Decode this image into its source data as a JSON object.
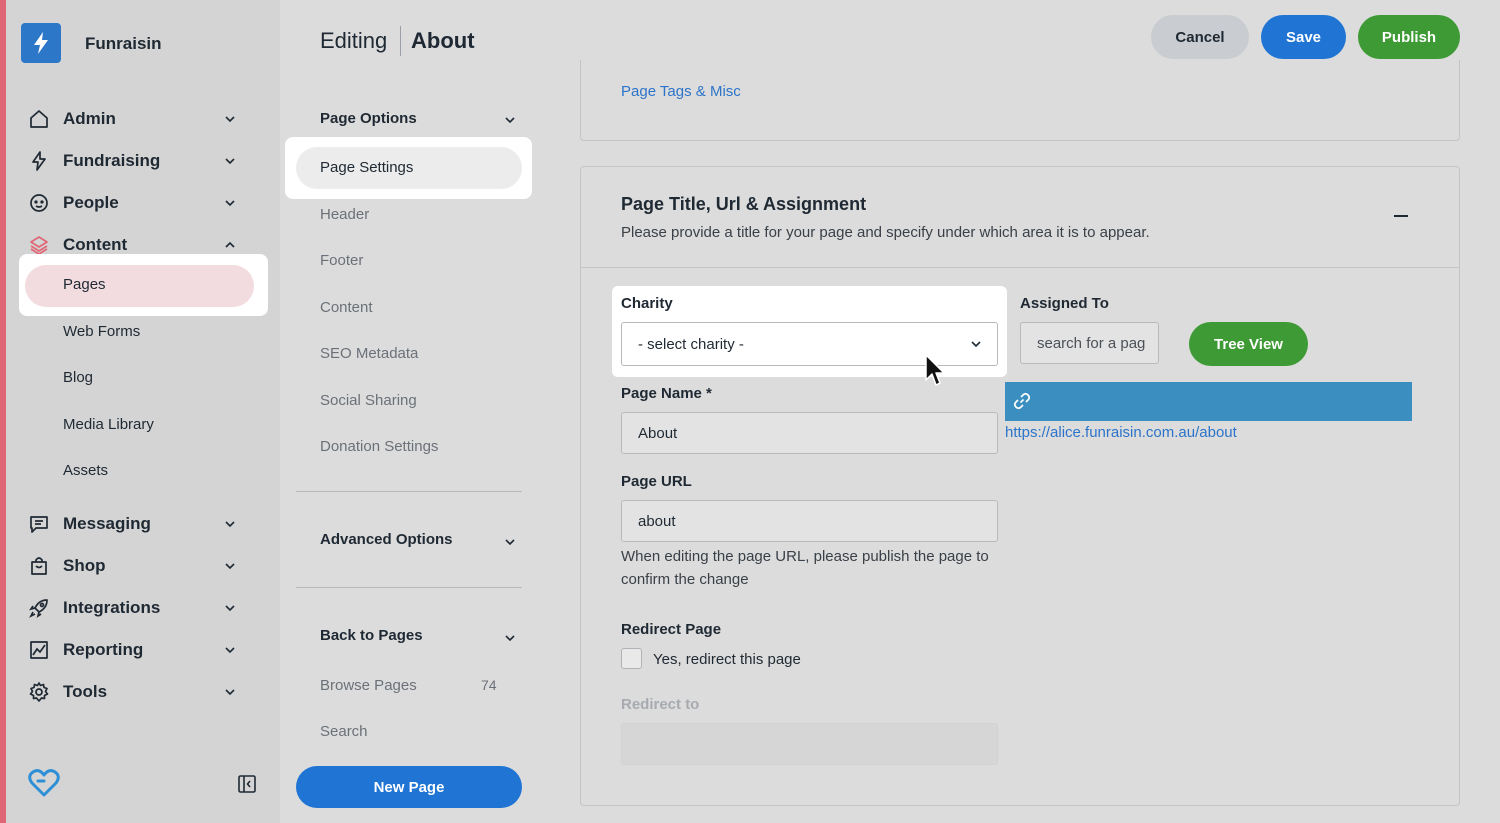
{
  "app": {
    "brand": "Funraisin",
    "colors": {
      "accent": "#e06676",
      "primary": "#1f74d4",
      "success": "#3d9a34",
      "link": "#2c74c9"
    }
  },
  "sidebar": {
    "nav": [
      {
        "label": "Admin",
        "icon": "home-icon"
      },
      {
        "label": "Fundraising",
        "icon": "lightning-icon"
      },
      {
        "label": "People",
        "icon": "face-icon"
      },
      {
        "label": "Content",
        "icon": "layers-icon",
        "expanded": true
      },
      {
        "label": "Messaging",
        "icon": "chat-icon"
      },
      {
        "label": "Shop",
        "icon": "shopping-bag-icon"
      },
      {
        "label": "Integrations",
        "icon": "rocket-icon"
      },
      {
        "label": "Reporting",
        "icon": "chart-icon"
      },
      {
        "label": "Tools",
        "icon": "gear-icon"
      }
    ],
    "content_items": [
      "Pages",
      "Web Forms",
      "Blog",
      "Media Library",
      "Assets"
    ],
    "active_item": "Pages"
  },
  "header": {
    "editing_label": "Editing",
    "page_title": "About",
    "cancel_label": "Cancel",
    "save_label": "Save",
    "publish_label": "Publish"
  },
  "page_options": {
    "title": "Page Options",
    "items": [
      "Page Settings",
      "Header",
      "Footer",
      "Content",
      "SEO Metadata",
      "Social Sharing",
      "Donation Settings"
    ],
    "active_item": "Page Settings",
    "advanced_title": "Advanced Options",
    "back_title": "Back to Pages",
    "browse_label": "Browse Pages",
    "browse_count": "74",
    "search_label": "Search",
    "new_page_label": "New Page"
  },
  "main": {
    "tags_link": "Page Tags & Misc",
    "section_title": "Page Title, Url & Assignment",
    "section_desc": "Please provide a title for your page and specify under which area it is to appear.",
    "charity_label": "Charity",
    "charity_value": "- select charity -",
    "assigned_label": "Assigned To",
    "assigned_placeholder": "search for a pag",
    "tree_view_label": "Tree View",
    "page_name_label": "Page Name *",
    "page_name_value": "About",
    "page_url_label": "Page URL",
    "page_url_value": "about",
    "url_help": "When editing the page URL, please publish the page to confirm the change",
    "full_url": "https://alice.funraisin.com.au/about",
    "redirect_label": "Redirect Page",
    "redirect_checkbox_label": "Yes, redirect this page",
    "redirect_checked": false,
    "redirect_to_label": "Redirect to",
    "redirect_to_value": ""
  }
}
